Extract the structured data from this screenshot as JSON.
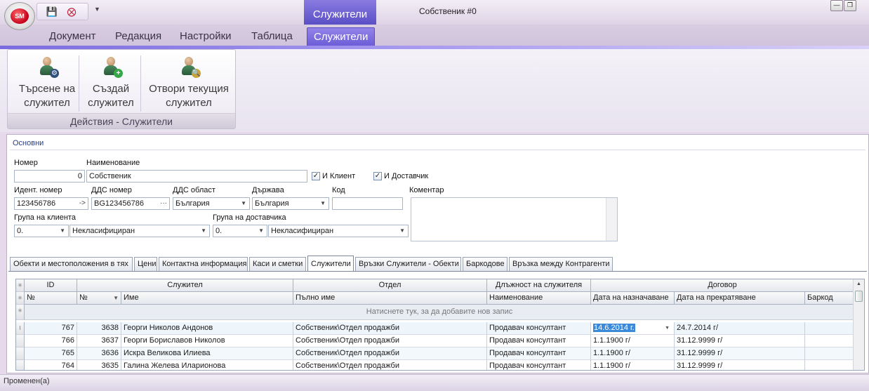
{
  "window": {
    "title": "Собственик #0",
    "context_tab_header": "Служители",
    "logo_text": "SM"
  },
  "ribbon": {
    "tabs": [
      "Документ",
      "Редакция",
      "Настройки",
      "Таблица",
      "Служители"
    ],
    "active_tab": "Служители",
    "group": {
      "label": "Действия - Служители",
      "buttons": [
        {
          "line1": "Търсене на",
          "line2": "служител",
          "icon": "employee-search-icon"
        },
        {
          "line1": "Създай",
          "line2": "служител",
          "icon": "employee-add-icon"
        },
        {
          "line1": "Отвори текущия",
          "line2": "служител",
          "icon": "employee-open-icon"
        }
      ]
    }
  },
  "form": {
    "section": "Основни",
    "number_label": "Номер",
    "number_value": "0",
    "name_label": "Наименование",
    "name_value": "Собственик",
    "client_label": "И Клиент",
    "client_checked": true,
    "supplier_label": "И Доставчик",
    "supplier_checked": true,
    "ident_label": "Идент. номер",
    "ident_value": "123456786",
    "ident_suffix": "->",
    "vat_label": "ДДС номер",
    "vat_value": "BG123456786",
    "vat_suffix": "···",
    "vat_region_label": "ДДС област",
    "vat_region_value": "България",
    "country_label": "Държава",
    "country_value": "България",
    "code_label": "Код",
    "code_value": "",
    "comment_label": "Коментар",
    "client_group_label": "Група на клиента",
    "client_group_code": "0.",
    "client_group_value": "Некласифициран",
    "supplier_group_label": "Група на доставчика",
    "supplier_group_code": "0.",
    "supplier_group_value": "Некласифициран"
  },
  "detail_tabs": [
    "Обекти и местоположения в тях",
    "Цени",
    "Контактна информация",
    "Каси и сметки",
    "Служители",
    "Връзки Служители - Обекти",
    "Баркодове",
    "Връзка между Контрагенти"
  ],
  "active_detail_tab": "Служители",
  "grid": {
    "bands": {
      "id": "ID",
      "employee": "Служител",
      "department": "Отдел",
      "position": "Длъжност на служителя",
      "contract": "Договор"
    },
    "columns": {
      "num": "№",
      "name": "Име",
      "full_name": "Пълно име",
      "position_name": "Наименование",
      "start": "Дата на назначаване",
      "end": "Дата на прекратяване",
      "barcode": "Баркод"
    },
    "new_row_hint": "Натиснете тук, за да добавите нов запис",
    "rows": [
      {
        "id": "767",
        "num": "3638",
        "name": "Георги Николов Андонов",
        "dept": "Собственик\\Отдел продажби",
        "position": "Продавач консултант",
        "start": "14.6.2014 г.",
        "end": "24.7.2014 г/",
        "barcode": ""
      },
      {
        "id": "766",
        "num": "3637",
        "name": "Георги Бориславов Николов",
        "dept": "Собственик\\Отдел продажби",
        "position": "Продавач консултант",
        "start": "1.1.1900 г/",
        "end": "31.12.9999 г/",
        "barcode": ""
      },
      {
        "id": "765",
        "num": "3636",
        "name": "Искра Великова Илиева",
        "dept": "Собственик\\Отдел продажби",
        "position": "Продавач консултант",
        "start": "1.1.1900 г/",
        "end": "31.12.9999 г/",
        "barcode": ""
      },
      {
        "id": "764",
        "num": "3635",
        "name": "Галина Желева Иларионова",
        "dept": "Собственик\\Отдел продажби",
        "position": "Продавач консултант",
        "start": "1.1.1900 г/",
        "end": "31.12.9999 г/",
        "barcode": ""
      }
    ]
  },
  "status": "Променен(а)",
  "colors": {
    "accent": "#6a5ad6",
    "selection": "#3b8ad9",
    "section_title": "#243e8a"
  }
}
